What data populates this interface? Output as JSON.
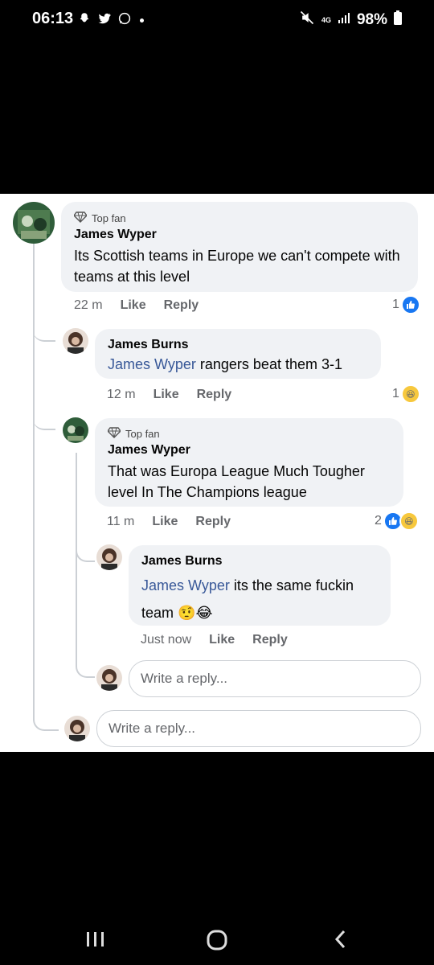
{
  "status": {
    "time": "06:13",
    "network": "4G",
    "battery": "98%"
  },
  "comment_main": {
    "badge": "Top fan",
    "author": "James Wyper",
    "text": "Its Scottish teams in Europe we can't compete with teams at this level",
    "time": "22 m",
    "like": "Like",
    "reply": "Reply",
    "reaction_count": "1"
  },
  "reply_1": {
    "author": "James Burns",
    "mention": "James Wyper",
    "text": "rangers beat them 3-1",
    "time": "12 m",
    "like": "Like",
    "reply": "Reply",
    "reaction_count": "1"
  },
  "reply_2": {
    "badge": "Top fan",
    "author": "James Wyper",
    "text": "That was Europa League Much Tougher level In The Champions league",
    "time": "11 m",
    "like": "Like",
    "reply": "Reply",
    "reaction_count": "2"
  },
  "reply_3": {
    "author": "James Burns",
    "mention": "James Wyper",
    "text": "its the same fuckin team",
    "emoji": "🤨😂",
    "time": "Just now",
    "like": "Like",
    "reply": "Reply"
  },
  "inputs": {
    "nested_reply_placeholder": "Write a reply...",
    "reply_placeholder": "Write a reply..."
  },
  "colors": {
    "like_blue": "#1877f2",
    "mention_blue": "#385898",
    "bubble_gray": "#f0f2f5"
  }
}
